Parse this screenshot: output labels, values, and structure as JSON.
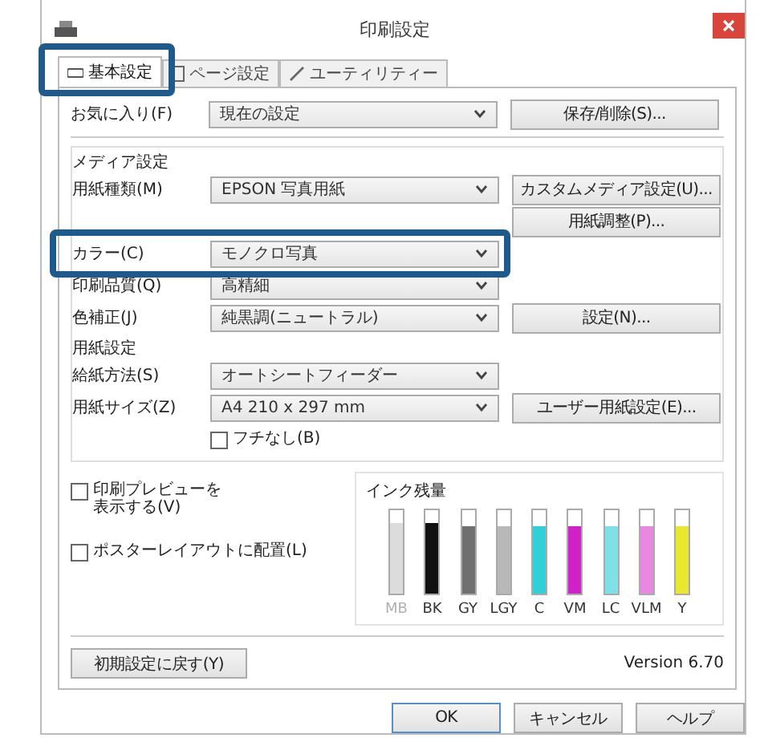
{
  "window": {
    "title": "印刷設定"
  },
  "tabs": [
    {
      "label": "基本設定",
      "selected": true,
      "highlighted": true
    },
    {
      "label": "ページ設定",
      "selected": false,
      "highlighted": false
    },
    {
      "label": "ユーティリティー",
      "selected": false,
      "highlighted": false
    }
  ],
  "favorites": {
    "label": "お気に入り(F)",
    "value": "現在の設定",
    "button": "保存/削除(S)..."
  },
  "media": {
    "title": "メディア設定",
    "rows": [
      {
        "kind": "select",
        "label": "用紙種類(M)",
        "value": "EPSON 写真用紙",
        "button": "カスタムメディア設定(U)...",
        "highlighted": false
      },
      {
        "kind": "button",
        "button": "用紙調整(P)..."
      },
      {
        "kind": "select",
        "label": "カラー(C)",
        "value": "モノクロ写真",
        "highlighted": true
      },
      {
        "kind": "select",
        "label": "印刷品質(Q)",
        "value": "高精細",
        "highlighted": false
      },
      {
        "kind": "select",
        "label": "色補正(J)",
        "value": "純黒調(ニュートラル)",
        "button": "設定(N)...",
        "highlighted": false
      }
    ]
  },
  "paper": {
    "title": "用紙設定",
    "rows": [
      {
        "kind": "select",
        "label": "給紙方法(S)",
        "value": "オートシートフィーダー",
        "highlighted": false
      },
      {
        "kind": "select",
        "label": "用紙サイズ(Z)",
        "value": "A4 210 x 297 mm",
        "button": "ユーザー用紙設定(E)...",
        "highlighted": false
      },
      {
        "kind": "checkbox",
        "label": "フチなし(B)",
        "checked": false
      }
    ]
  },
  "options": [
    {
      "label": "印刷プレビューを表示する(V)",
      "checked": false
    },
    {
      "label": "ポスターレイアウトに配置(L)",
      "checked": false
    }
  ],
  "ink": {
    "title": "インク残量",
    "inks": [
      {
        "name": "MB",
        "color": "#dcdcdc",
        "level": 0.85,
        "disabled": true
      },
      {
        "name": "BK",
        "color": "#111111",
        "level": 0.85,
        "disabled": false
      },
      {
        "name": "GY",
        "color": "#707070",
        "level": 0.8,
        "disabled": false
      },
      {
        "name": "LGY",
        "color": "#b8b8b8",
        "level": 0.8,
        "disabled": false
      },
      {
        "name": "C",
        "color": "#30d0d8",
        "level": 0.8,
        "disabled": false
      },
      {
        "name": "VM",
        "color": "#d020c8",
        "level": 0.8,
        "disabled": false
      },
      {
        "name": "LC",
        "color": "#80e0e8",
        "level": 0.8,
        "disabled": false
      },
      {
        "name": "VLM",
        "color": "#e888e0",
        "level": 0.8,
        "disabled": false
      },
      {
        "name": "Y",
        "color": "#e8e830",
        "level": 0.8,
        "disabled": false
      }
    ]
  },
  "reset_button": "初期設定に戻す(Y)",
  "version": "Version 6.70",
  "footer_buttons": [
    {
      "label": "OK",
      "default": true
    },
    {
      "label": "キャンセル",
      "default": false
    },
    {
      "label": "ヘルプ",
      "default": false
    }
  ]
}
